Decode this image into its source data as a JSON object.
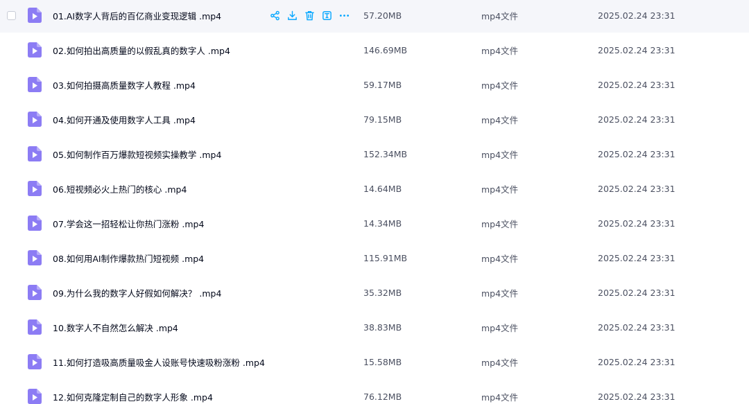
{
  "colors": {
    "accent": "#06a7ff",
    "file_icon": "#8c7cf4",
    "hover_row": "#f5f6fa"
  },
  "icons": {
    "video_file": "video-file-icon",
    "share": "share-icon",
    "download": "download-icon",
    "delete": "delete-icon",
    "rename": "rename-icon",
    "more": "more-icon"
  },
  "files": [
    {
      "name": "01.AI数字人背后的百亿商业变现逻辑 .mp4",
      "size": "57.20MB",
      "type": "mp4文件",
      "date": "2025.02.24 23:31"
    },
    {
      "name": "02.如何拍出高质量的以假乱真的数字人 .mp4",
      "size": "146.69MB",
      "type": "mp4文件",
      "date": "2025.02.24 23:31"
    },
    {
      "name": "03.如何拍摄高质量数字人教程 .mp4",
      "size": "59.17MB",
      "type": "mp4文件",
      "date": "2025.02.24 23:31"
    },
    {
      "name": "04.如何开通及使用数字人工具 .mp4",
      "size": "79.15MB",
      "type": "mp4文件",
      "date": "2025.02.24 23:31"
    },
    {
      "name": "05.如何制作百万爆款短视频实操教学 .mp4",
      "size": "152.34MB",
      "type": "mp4文件",
      "date": "2025.02.24 23:31"
    },
    {
      "name": "06.短视频必火上热门的核心 .mp4",
      "size": "14.64MB",
      "type": "mp4文件",
      "date": "2025.02.24 23:31"
    },
    {
      "name": "07.学会这一招轻松让你热门涨粉 .mp4",
      "size": "14.34MB",
      "type": "mp4文件",
      "date": "2025.02.24 23:31"
    },
    {
      "name": "08.如何用AI制作爆款热门短视频 .mp4",
      "size": "115.91MB",
      "type": "mp4文件",
      "date": "2025.02.24 23:31"
    },
    {
      "name": "09.为什么我的数字人好假如何解决？ .mp4",
      "size": "35.32MB",
      "type": "mp4文件",
      "date": "2025.02.24 23:31"
    },
    {
      "name": "10.数字人不自然怎么解决 .mp4",
      "size": "38.83MB",
      "type": "mp4文件",
      "date": "2025.02.24 23:31"
    },
    {
      "name": "11.如何打造吸高质量吸金人设账号快速吸粉涨粉 .mp4",
      "size": "15.58MB",
      "type": "mp4文件",
      "date": "2025.02.24 23:31"
    },
    {
      "name": "12.如何克隆定制自己的数字人形象 .mp4",
      "size": "76.12MB",
      "type": "mp4文件",
      "date": "2025.02.24 23:31"
    }
  ]
}
